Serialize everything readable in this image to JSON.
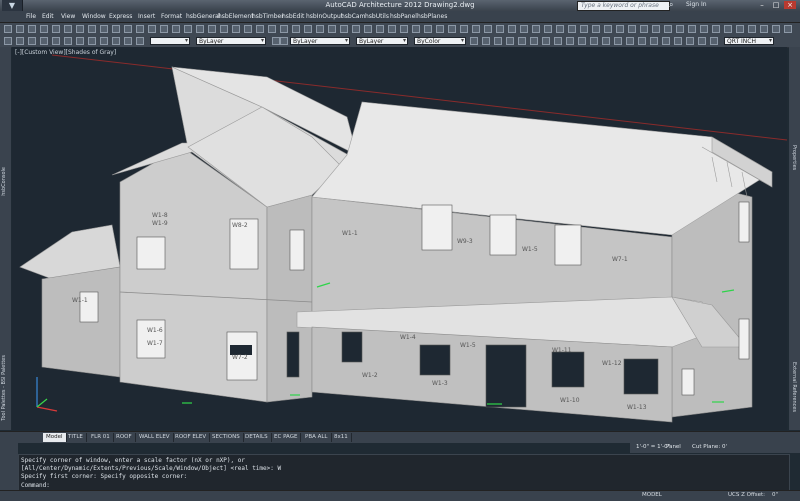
{
  "title_bar": {
    "title": "AutoCAD Architecture 2012  Drawing2.dwg",
    "search_placeholder": "Type a keyword or phrase",
    "sign_in": "Sign In"
  },
  "menu": [
    "File",
    "Edit",
    "View",
    "Window",
    "Express",
    "Insert",
    "Format",
    "hsbGeneral",
    "hsbElement",
    "hsbTimber",
    "hsbEdit",
    "hsbInOutput",
    "hsbCam",
    "hsbUtils",
    "hsbPanel",
    "hsbPlanes"
  ],
  "toolbar": {
    "layer": "ByLayer",
    "linetype": "ByLayer",
    "lineweight": "ByLayer",
    "color": "ByColor",
    "text_style": "QRT INCH"
  },
  "side_palettes": {
    "left_top": "hsbConsole",
    "left_bottom": "Tool Palettes - BSI Palettes",
    "right_top": "Properties",
    "right_bottom": "External References"
  },
  "viewport": {
    "label": "[-][Custom View][Shades of Gray]",
    "wall_labels": [
      "W1-8",
      "W1-9",
      "W1-5",
      "W8-2",
      "W1-1",
      "W9-3",
      "W1-6",
      "W1-7",
      "W7-2",
      "W1-4",
      "W1-3",
      "W1-2",
      "W1-5",
      "W1-10",
      "W1-12",
      "W1-13",
      "W1-1",
      "W7-1",
      "W1-11"
    ]
  },
  "tabs": [
    "Model",
    "TITLE",
    "FLR 01",
    "ROOF",
    "WALL ELEV",
    "ROOF ELEV",
    "SECTIONS",
    "DETAILS",
    "EC PAGE",
    "PBA ALL",
    "8x11"
  ],
  "command": {
    "lines": [
      "Specify corner of window, enter a scale factor (nX or nXP), or",
      "[All/Center/Dynamic/Extents/Previous/Scale/Window/Object] <real time>: W",
      "Specify first corner: Specify opposite corner:"
    ],
    "prompt": "Command:"
  },
  "info_bar": {
    "scale": "1'-0\" = 1'-0\"",
    "panel": "Panel",
    "cut_plane_label": "Cut Plane:",
    "cut_plane_value": "0'"
  },
  "status": {
    "model": "MODEL",
    "ucs": "UCS Z Offset:",
    "ucs_value": "0\""
  },
  "colors": {
    "background": "#1f2a33",
    "wall": "#c8c8c8",
    "roof": "#e2e2e2",
    "accent_green": "#2fd44a",
    "axis_red": "#a03030"
  }
}
